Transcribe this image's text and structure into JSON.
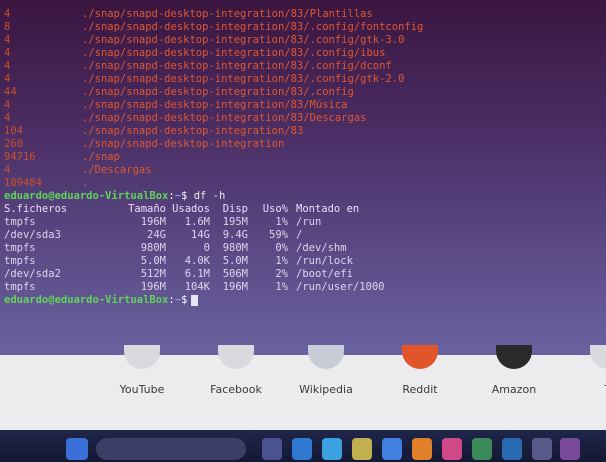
{
  "terminal": {
    "du_lines": [
      {
        "size": "4",
        "path": "./snap/snapd-desktop-integration/83/Plantillas"
      },
      {
        "size": "8",
        "path": "./snap/snapd-desktop-integration/83/.config/fontconfig"
      },
      {
        "size": "4",
        "path": "./snap/snapd-desktop-integration/83/.config/gtk-3.0"
      },
      {
        "size": "4",
        "path": "./snap/snapd-desktop-integration/83/.config/ibus"
      },
      {
        "size": "4",
        "path": "./snap/snapd-desktop-integration/83/.config/dconf"
      },
      {
        "size": "4",
        "path": "./snap/snapd-desktop-integration/83/.config/gtk-2.0"
      },
      {
        "size": "44",
        "path": "./snap/snapd-desktop-integration/83/.config"
      },
      {
        "size": "4",
        "path": "./snap/snapd-desktop-integration/83/Música"
      },
      {
        "size": "4",
        "path": "./snap/snapd-desktop-integration/83/Descargas"
      },
      {
        "size": "104",
        "path": "./snap/snapd-desktop-integration/83"
      },
      {
        "size": "260",
        "path": "./snap/snapd-desktop-integration"
      },
      {
        "size": "94716",
        "path": "./snap"
      },
      {
        "size": "4",
        "path": "./Descargas"
      },
      {
        "size": "189484",
        "path": "."
      }
    ],
    "prompt": {
      "user": "eduardo@eduardo-VirtualBox",
      "sep": ":",
      "dir": "~",
      "symbol": "$"
    },
    "command": "df -h",
    "df_header": [
      "S.ficheros",
      "Tamaño",
      "Usados",
      "Disp",
      "Uso%",
      "Montado en"
    ],
    "df_rows": [
      [
        "tmpfs",
        "196M",
        "1.6M",
        "195M",
        "1%",
        "/run"
      ],
      [
        "/dev/sda3",
        "24G",
        "14G",
        "9.4G",
        "59%",
        "/"
      ],
      [
        "tmpfs",
        "980M",
        "0",
        "980M",
        "0%",
        "/dev/shm"
      ],
      [
        "tmpfs",
        "5.0M",
        "4.0K",
        "5.0M",
        "1%",
        "/run/lock"
      ],
      [
        "/dev/sda2",
        "512M",
        "6.1M",
        "506M",
        "2%",
        "/boot/efi"
      ],
      [
        "tmpfs",
        "196M",
        "104K",
        "196M",
        "1%",
        "/run/user/1000"
      ]
    ]
  },
  "browser": {
    "shortcuts": [
      {
        "label": "YouTube",
        "color": "#d9d9de"
      },
      {
        "label": "Facebook",
        "color": "#d9d9de"
      },
      {
        "label": "Wikipedia",
        "color": "#c9ccd6"
      },
      {
        "label": "Reddit",
        "color": "#e0552a"
      },
      {
        "label": "Amazon",
        "color": "#2a2a2a"
      },
      {
        "label": "T",
        "color": "#d9d9de"
      }
    ]
  }
}
